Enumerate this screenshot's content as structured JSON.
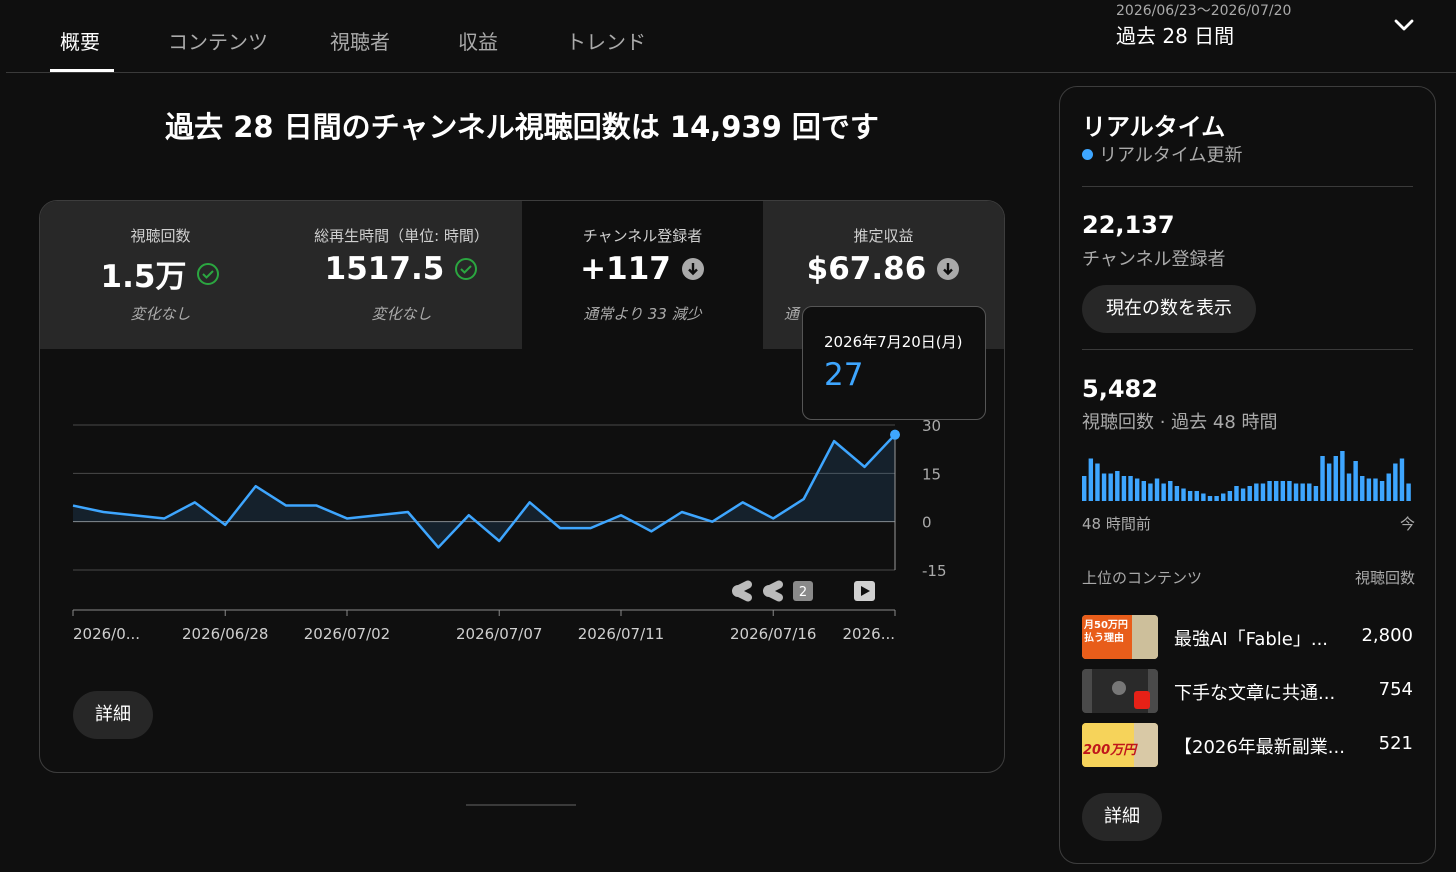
{
  "tabs": [
    {
      "label": "概要",
      "active": true
    },
    {
      "label": "コンテンツ"
    },
    {
      "label": "視聴者"
    },
    {
      "label": "収益"
    },
    {
      "label": "トレンド"
    }
  ],
  "period": {
    "range": "2026/06/23〜2026/07/20",
    "label": "過去 28 日間",
    "icon": "chevron-down-icon"
  },
  "headline": "過去 28 日間のチャンネル視聴回数は 14,939 回です",
  "metrics": [
    {
      "label": "視聴回数",
      "value": "1.5万",
      "status_icon": "check-circle-icon",
      "sub": "変化なし"
    },
    {
      "label": "総再生時間（単位: 時間）",
      "value": "1517.5",
      "status_icon": "check-circle-icon",
      "sub": "変化なし"
    },
    {
      "label": "チャンネル登録者",
      "value": "+117",
      "status_icon": "arrow-down-circle-icon",
      "sub": "通常より 33 減少",
      "selected": true
    },
    {
      "label": "推定収益",
      "value": "$67.86",
      "status_icon": "arrow-down-circle-icon",
      "sub": "通"
    }
  ],
  "tooltip": {
    "date": "2026年7月20日(月)",
    "value": "27"
  },
  "chart_data": {
    "type": "area",
    "series": [
      {
        "values": [
          5,
          3,
          2,
          1,
          6,
          -1,
          11,
          5,
          5,
          1,
          2,
          3,
          -8,
          2,
          -6,
          6,
          -2,
          -2,
          2,
          -3,
          3,
          0,
          6,
          1,
          7,
          25,
          17,
          27
        ]
      }
    ],
    "yticks": [
      "30",
      "15",
      "0",
      "-15"
    ],
    "ylim": [
      -15,
      30
    ],
    "xtick_labels": [
      "2026/0...",
      "2026/06/28",
      "2026/07/02",
      "2026/07/07",
      "2026/07/11",
      "2026/07/16",
      "2026..."
    ],
    "grid": true,
    "color": "#3ea6ff"
  },
  "chart_markers": {
    "badge_count": "2"
  },
  "detail_label": "詳細",
  "realtime": {
    "title": "リアルタイム",
    "live_label": "リアルタイム更新",
    "subscribers": {
      "value": "22,137",
      "label": "チャンネル登録者"
    },
    "show_count_label": "現在の数を表示",
    "views": {
      "value": "5,482",
      "label": "視聴回数 · 過去 48 時間"
    },
    "bars": [
      0.5,
      0.85,
      0.75,
      0.55,
      0.55,
      0.6,
      0.5,
      0.5,
      0.45,
      0.4,
      0.35,
      0.45,
      0.35,
      0.4,
      0.3,
      0.25,
      0.2,
      0.2,
      0.15,
      0.1,
      0.1,
      0.15,
      0.2,
      0.3,
      0.25,
      0.3,
      0.35,
      0.35,
      0.4,
      0.4,
      0.4,
      0.4,
      0.35,
      0.35,
      0.35,
      0.3,
      0.9,
      0.75,
      0.9,
      1.0,
      0.55,
      0.8,
      0.5,
      0.45,
      0.45,
      0.4,
      0.55,
      0.75,
      0.85,
      0.35
    ],
    "axis_start": "48 時間前",
    "axis_end": "今",
    "top_content_label": "上位のコンテンツ",
    "views_col_label": "視聴回数",
    "top_content": [
      {
        "title": "最強AI「Fable」...",
        "views": "2,800",
        "thumb_text": "月50万円払う理由"
      },
      {
        "title": "下手な文章に共通...",
        "views": "754",
        "thumb_text": ""
      },
      {
        "title": "【2026年最新副業...",
        "views": "521",
        "thumb_text": "200万円"
      }
    ],
    "detail_label": "詳細"
  },
  "colors": {
    "accent": "#3ea6ff",
    "check": "#2ba640",
    "bg": "#0f0f0f"
  }
}
